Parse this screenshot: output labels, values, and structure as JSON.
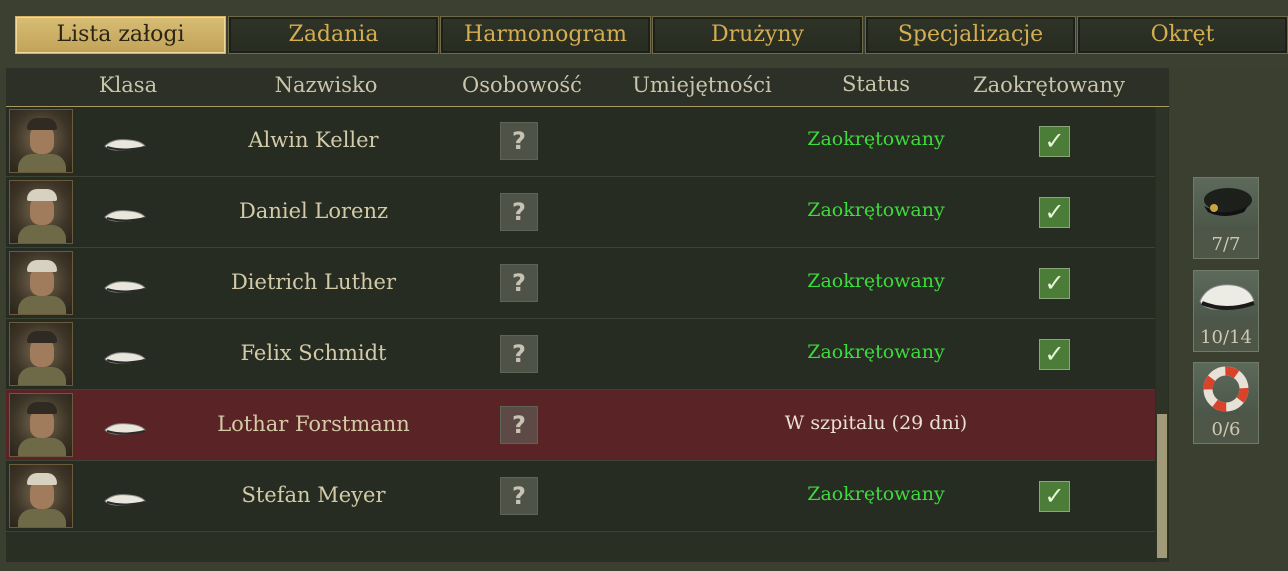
{
  "tabs": [
    {
      "label": "Lista załogi",
      "active": true
    },
    {
      "label": "Zadania",
      "active": false
    },
    {
      "label": "Harmonogram",
      "active": false
    },
    {
      "label": "Drużyny",
      "active": false
    },
    {
      "label": "Specjalizacje",
      "active": false
    },
    {
      "label": "Okręt",
      "active": false
    }
  ],
  "columns": {
    "klasa": "Klasa",
    "nazwisko": "Nazwisko",
    "osobowosc": "Osobowość",
    "umiejetnosci": "Umiejętności",
    "status": "Status",
    "zaokretowany": "Zaokrętowany"
  },
  "crew": [
    {
      "name": "",
      "status": "",
      "embarked": true,
      "personality": "?",
      "state": "normal",
      "cap": "light",
      "class_icon": "sailor-cap-icon"
    },
    {
      "name": "Alwin Keller",
      "status": "Zaokrętowany",
      "embarked": true,
      "personality": "?",
      "state": "normal",
      "cap": "dark",
      "class_icon": "sailor-cap-icon"
    },
    {
      "name": "Daniel Lorenz",
      "status": "Zaokrętowany",
      "embarked": true,
      "personality": "?",
      "state": "normal",
      "cap": "light",
      "class_icon": "sailor-cap-icon"
    },
    {
      "name": "Dietrich Luther",
      "status": "Zaokrętowany",
      "embarked": true,
      "personality": "?",
      "state": "normal",
      "cap": "light",
      "class_icon": "sailor-cap-icon"
    },
    {
      "name": "Felix Schmidt",
      "status": "Zaokrętowany",
      "embarked": true,
      "personality": "?",
      "state": "normal",
      "cap": "dark",
      "class_icon": "sailor-cap-icon"
    },
    {
      "name": "Lothar Forstmann",
      "status": "W szpitalu (29 dni)",
      "embarked": false,
      "personality": "?",
      "state": "hospital",
      "cap": "dark",
      "class_icon": "sailor-cap-icon"
    },
    {
      "name": "Stefan Meyer",
      "status": "Zaokrętowany",
      "embarked": true,
      "personality": "?",
      "state": "normal",
      "cap": "light",
      "class_icon": "sailor-cap-icon"
    }
  ],
  "sidebar": [
    {
      "icon": "officer-cap-icon",
      "count": "7/7"
    },
    {
      "icon": "sailor-cap-icon",
      "count": "10/14"
    },
    {
      "icon": "life-ring-icon",
      "count": "0/6"
    }
  ],
  "colors": {
    "accent": "#d4ae53",
    "status_green": "#3ddb3d",
    "hospital_row": "#5a2325"
  }
}
